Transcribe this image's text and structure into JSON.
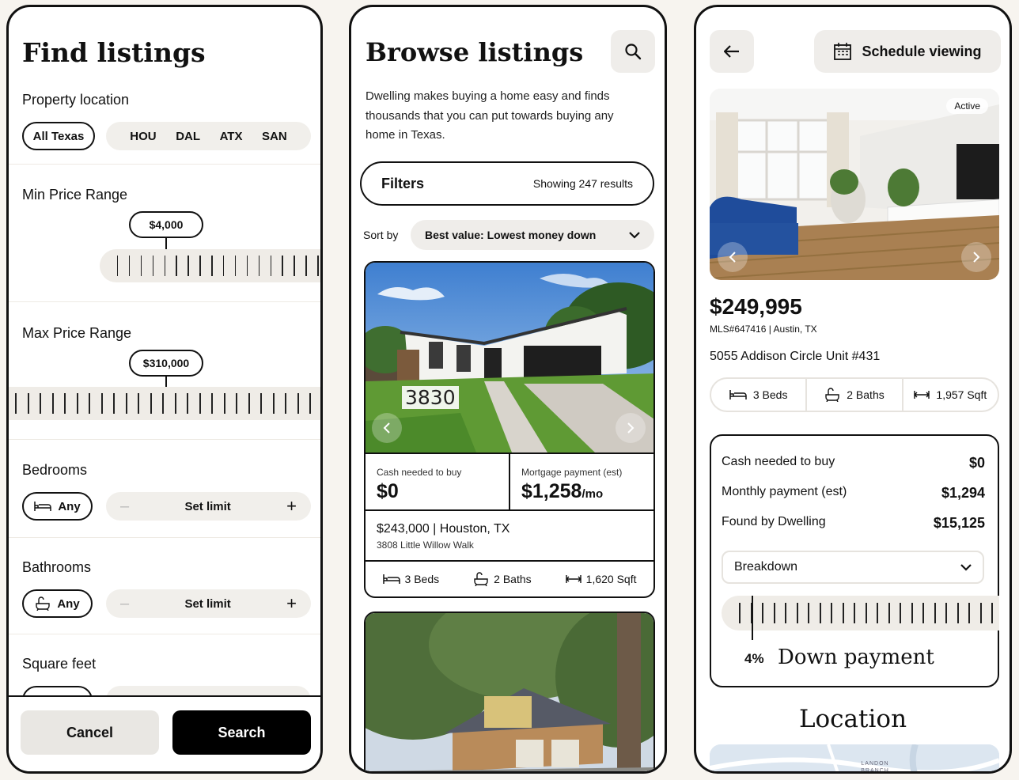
{
  "find": {
    "title": "Find listings",
    "location_label": "Property location",
    "location_all": "All Texas",
    "cities": [
      "HOU",
      "DAL",
      "ATX",
      "SAN"
    ],
    "min_price_label": "Min Price Range",
    "min_price_value": "$4,000",
    "max_price_label": "Max Price Range",
    "max_price_value": "$310,000",
    "bedrooms_label": "Bedrooms",
    "bathrooms_label": "Bathrooms",
    "sqft_label": "Square feet",
    "any_label": "Any",
    "set_limit_label": "Set limit",
    "minus": "–",
    "plus": "+",
    "cancel_label": "Cancel",
    "search_label": "Search"
  },
  "browse": {
    "title": "Browse listings",
    "description": "Dwelling makes buying a home easy and finds thousands that you can put towards buying any home in Texas.",
    "filters_label": "Filters",
    "results_text": "Showing 247 results",
    "sort_label": "Sort by",
    "sort_value": "Best value: Lowest money down",
    "listing": {
      "house_number": "3830",
      "cash_label": "Cash needed to buy",
      "cash_value": "$0",
      "mortgage_label": "Mortgage payment (est)",
      "mortgage_value": "$1,258",
      "mortgage_unit": "/mo",
      "price_city": "$243,000 | Houston, TX",
      "street": "3808 Little Willow Walk",
      "beds": "3 Beds",
      "baths": "2 Baths",
      "sqft": "1,620 Sqft"
    }
  },
  "detail": {
    "schedule_label": "Schedule viewing",
    "status_badge": "Active",
    "price": "$249,995",
    "mls": "MLS#647416 | Austin, TX",
    "address": "5055 Addison Circle Unit #431",
    "beds": "3 Beds",
    "baths": "2 Baths",
    "sqft": "1,957 Sqft",
    "cash_label": "Cash needed to buy",
    "cash_value": "$0",
    "monthly_label": "Monthly payment (est)",
    "monthly_value": "$1,294",
    "found_label": "Found by Dwelling",
    "found_value": "$15,125",
    "breakdown_label": "Breakdown",
    "down_payment_pct": "4%",
    "down_payment_label": "Down payment",
    "location_heading": "Location",
    "map_label": "LANDON BRANCH"
  },
  "colors": {
    "ink": "#111111",
    "pill_grey": "#f1efeb",
    "background": "#f7f4ef"
  }
}
